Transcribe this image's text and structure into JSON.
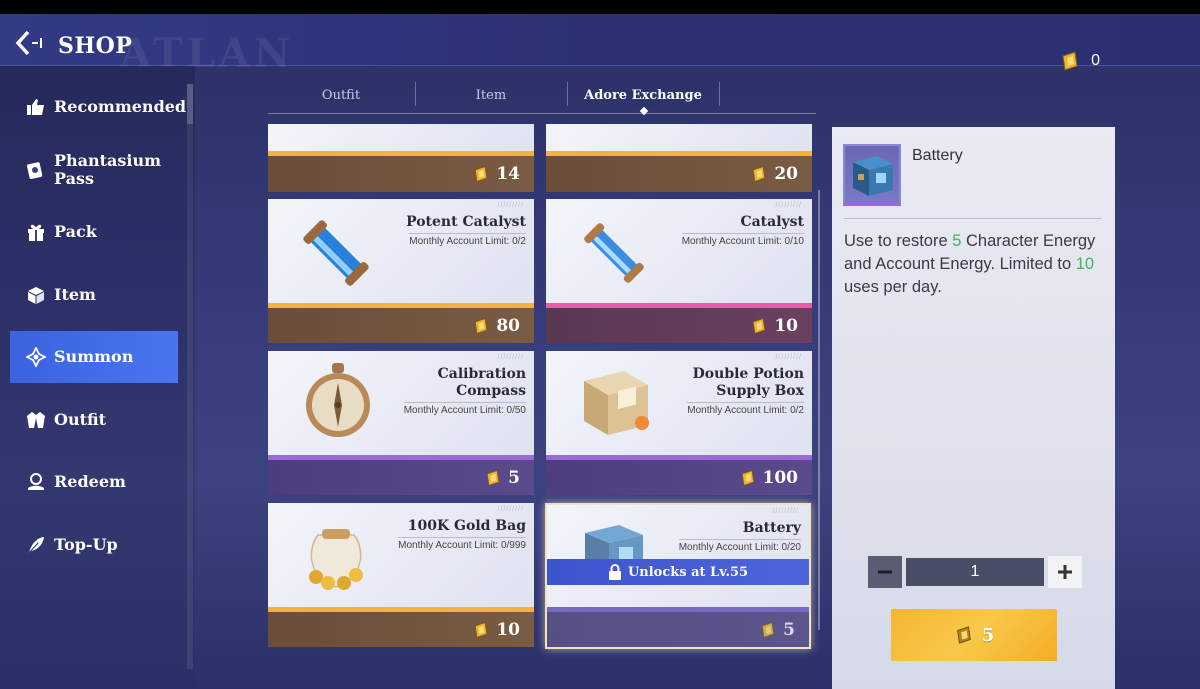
{
  "header": {
    "title": "SHOP",
    "watermark": "ATLAN",
    "currency_count": "0"
  },
  "sidebar": {
    "items": [
      {
        "label": "Recommended",
        "icon": "thumbs-up-icon"
      },
      {
        "label": "Phantasium Pass",
        "label_line1": "Phantasium",
        "label_line2": "Pass",
        "icon": "card-icon"
      },
      {
        "label": "Pack",
        "icon": "gift-icon"
      },
      {
        "label": "Item",
        "icon": "cube-icon"
      },
      {
        "label": "Summon",
        "icon": "summon-icon",
        "active": true
      },
      {
        "label": "Outfit",
        "icon": "jacket-icon"
      },
      {
        "label": "Redeem",
        "icon": "redeem-icon"
      },
      {
        "label": "Top-Up",
        "icon": "feather-icon"
      }
    ]
  },
  "tabs": [
    {
      "label": "Outfit"
    },
    {
      "label": "Item"
    },
    {
      "label": "Adore Exchange",
      "active": true
    }
  ],
  "cards": [
    {
      "price": "14"
    },
    {
      "price": "20"
    },
    {
      "name": "Potent Catalyst",
      "limit": "Monthly Account Limit: 0/2",
      "price": "80"
    },
    {
      "name": "Catalyst",
      "limit": "Monthly Account Limit: 0/10",
      "price": "10"
    },
    {
      "name_line1": "Calibration",
      "name_line2": "Compass",
      "limit": "Monthly Account Limit: 0/50",
      "price": "5"
    },
    {
      "name_line1": "Double Potion",
      "name_line2": "Supply Box",
      "limit": "Monthly Account Limit: 0/2",
      "price": "100"
    },
    {
      "name": "100K Gold Bag",
      "limit": "Monthly Account Limit: 0/999",
      "price": "10"
    },
    {
      "name": "Battery",
      "limit": "Monthly Account Limit: 0/20",
      "price": "5",
      "lock_text": "Unlocks at Lv.55"
    }
  ],
  "detail": {
    "name": "Battery",
    "desc_1": "Use to restore ",
    "desc_num1": "5",
    "desc_2": " Character Energy and Account Energy. Limited to ",
    "desc_num2": "10",
    "desc_3": " uses per day.",
    "quantity": "1",
    "buy_price": "5"
  },
  "colors": {
    "accent_active": "#4a74f0",
    "buy_button": "#f9c84a",
    "highlight_green": "#3db85c"
  }
}
